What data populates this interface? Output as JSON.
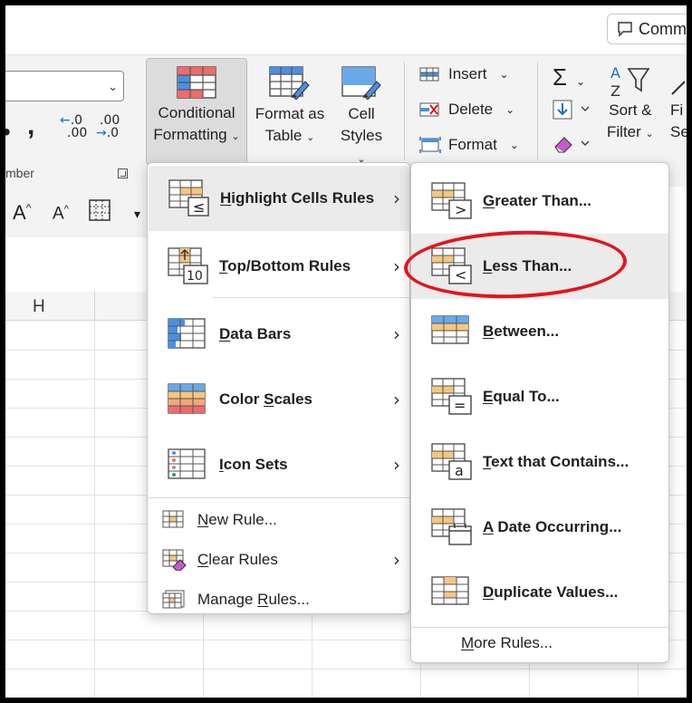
{
  "ribbon": {
    "comments_label": "Comm",
    "group_label": "mber",
    "conditional_formatting": {
      "line1": "Conditional",
      "line2": "Formatting"
    },
    "format_as_table": {
      "line1": "Format as",
      "line2": "Table"
    },
    "cell_styles": {
      "line1": "Cell",
      "line2": "Styles"
    },
    "insert_label": "Insert",
    "delete_label": "Delete",
    "format_label": "Format",
    "sort_filter": {
      "line1": "Sort &",
      "line2": "Filter"
    },
    "find_select": {
      "line1": "Fi",
      "line2": "Se"
    },
    "comma": ",",
    "dec_increase": {
      "top": ".0",
      "bottom": ".00"
    },
    "dec_decrease": {
      "top": ".00",
      "bottom": ".0"
    }
  },
  "font_row": {
    "grow": "A^",
    "shrink": "A^"
  },
  "sheet": {
    "column_header": "H"
  },
  "menu_cf": {
    "items": [
      {
        "label": "Highlight Cells Rules",
        "accel": "H",
        "rest": "ighlight Cells Rules"
      },
      {
        "label": "Top/Bottom Rules",
        "accel": "T",
        "rest": "op/Bottom Rules"
      },
      {
        "label": "Data Bars",
        "accel": "D",
        "rest": "ata Bars"
      },
      {
        "label": "Color Scales",
        "pre": "Color ",
        "accel": "S",
        "rest": "cales"
      },
      {
        "label": "Icon Sets",
        "accel": "I",
        "rest": "con Sets"
      },
      {
        "label": "New Rule...",
        "accel": "N",
        "rest": "ew Rule..."
      },
      {
        "label": "Clear Rules",
        "accel": "C",
        "rest": "lear Rules"
      },
      {
        "label": "Manage Rules...",
        "pre": "Manage ",
        "accel": "R",
        "rest": "ules..."
      }
    ],
    "icon_badges": {
      "highlight": "≤",
      "topbottom": "10"
    }
  },
  "menu_hcr": {
    "items": [
      {
        "label": "Greater Than...",
        "accel": "G",
        "rest": "reater Than..."
      },
      {
        "label": "Less Than...",
        "accel": "L",
        "rest": "ess Than..."
      },
      {
        "label": "Between...",
        "accel": "B",
        "rest": "etween..."
      },
      {
        "label": "Equal To...",
        "accel": "E",
        "rest": "qual To..."
      },
      {
        "label": "Text that Contains...",
        "accel": "T",
        "rest": "ext that Contains..."
      },
      {
        "label": "A Date Occurring...",
        "accel": "A",
        "rest": " Date Occurring..."
      },
      {
        "label": "Duplicate Values...",
        "accel": "D",
        "rest": "uplicate Values..."
      }
    ],
    "more_rules": {
      "accel": "M",
      "rest": "ore Rules..."
    },
    "icon_badges": {
      "gt": ">",
      "lt": "<",
      "eq": "=",
      "text": "a"
    }
  },
  "colors": {
    "annotation": "#e3141c",
    "accent_blue": "#1a6dc9",
    "highlight_orange": "#f5c77e",
    "bar_red": "#ef6b6b"
  }
}
